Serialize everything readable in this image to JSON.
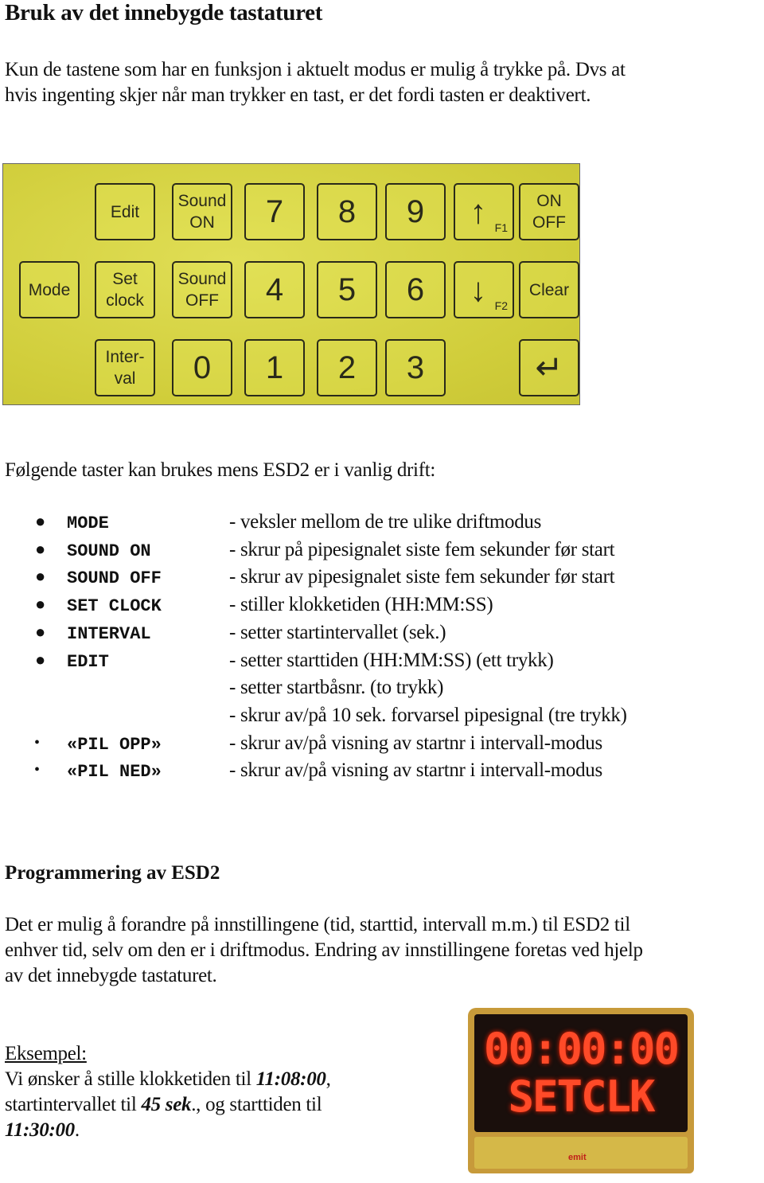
{
  "title": "Bruk av det innebygde tastaturet",
  "intro": [
    "Kun de tastene som har en funksjon i aktuelt modus er mulig å trykke på.  Dvs at",
    "hvis ingenting skjer når man trykker en tast, er det fordi tasten er deaktivert."
  ],
  "keypad": {
    "image_description": "Photo of the built-in yellow membrane keypad",
    "rows": [
      [
        {
          "label_lines": [
            "Edit"
          ],
          "type": "text"
        },
        {
          "label_lines": [
            "Sound",
            "ON"
          ],
          "type": "text"
        },
        {
          "label_lines": [
            "7"
          ],
          "type": "num"
        },
        {
          "label_lines": [
            "8"
          ],
          "type": "num"
        },
        {
          "label_lines": [
            "9"
          ],
          "type": "num"
        },
        {
          "label_lines": [
            "↑"
          ],
          "fn": "F1",
          "type": "arrow"
        },
        {
          "label_lines": [
            "ON",
            "OFF"
          ],
          "type": "text"
        }
      ],
      [
        {
          "label_lines": [
            "Mode"
          ],
          "type": "text"
        },
        {
          "label_lines": [
            "Set",
            "clock"
          ],
          "type": "text"
        },
        {
          "label_lines": [
            "Sound",
            "OFF"
          ],
          "type": "text"
        },
        {
          "label_lines": [
            "4"
          ],
          "type": "num"
        },
        {
          "label_lines": [
            "5"
          ],
          "type": "num"
        },
        {
          "label_lines": [
            "6"
          ],
          "type": "num"
        },
        {
          "label_lines": [
            "↓"
          ],
          "fn": "F2",
          "type": "arrow"
        },
        {
          "label_lines": [
            "Clear"
          ],
          "type": "text"
        }
      ],
      [
        {
          "label_lines": [
            "Inter-",
            "val"
          ],
          "type": "text"
        },
        {
          "label_lines": [
            "0"
          ],
          "type": "num"
        },
        {
          "label_lines": [
            "1"
          ],
          "type": "num"
        },
        {
          "label_lines": [
            "2"
          ],
          "type": "num"
        },
        {
          "label_lines": [
            "3"
          ],
          "type": "num"
        },
        {
          "label_lines": [
            "↵"
          ],
          "type": "enter"
        }
      ]
    ]
  },
  "normal_mode": {
    "heading": "Følgende taster kan brukes mens ESD2 er i vanlig drift:",
    "keys": [
      {
        "bullet": "●",
        "name": "MODE",
        "desc": "- veksler mellom de tre ulike driftmodus"
      },
      {
        "bullet": "●",
        "name": "SOUND ON",
        "desc": "- skrur på pipesignalet siste fem sekunder før start"
      },
      {
        "bullet": "●",
        "name": "SOUND OFF",
        "desc": "- skrur av pipesignalet siste fem sekunder før start"
      },
      {
        "bullet": "●",
        "name": "SET CLOCK",
        "desc": "- stiller klokketiden (HH:MM:SS)"
      },
      {
        "bullet": "●",
        "name": "INTERVAL",
        "desc": "- setter startintervallet (sek.)"
      },
      {
        "bullet": "●",
        "name": "EDIT",
        "desc": "- setter starttiden (HH:MM:SS) (ett trykk)"
      },
      {
        "bullet": "",
        "name": "",
        "desc": "- setter startbåsnr. (to trykk)"
      },
      {
        "bullet": "",
        "name": "",
        "desc": "- skrur av/på 10 sek. forvarsel pipesignal (tre trykk)"
      },
      {
        "bullet": "•",
        "name": "«PIL OPP»",
        "desc": "- skrur av/på visning av startnr i intervall-modus"
      },
      {
        "bullet": "•",
        "name": "«PIL NED»",
        "desc": "- skrur av/på visning av startnr i intervall-modus"
      }
    ]
  },
  "programming": {
    "heading": "Programmering av ESD2",
    "text": [
      "Det er mulig å forandre på innstillingene (tid, starttid, intervall m.m.) til ESD2 til",
      "enhver tid, selv om den er i driftmodus.  Endring av innstillingene foretas ved hjelp",
      "av det innebygde tastaturet."
    ]
  },
  "example": {
    "label": "Eksempel:",
    "line1_pre": "Vi ønsker å stille klokketiden til ",
    "clock_time": "11:08:00",
    "line1_post": ",",
    "line2_pre": "startintervallet til ",
    "interval": "45 sek",
    "line2_post": "., og starttiden  til",
    "start_time": "11:30:00",
    "line3_post": "."
  },
  "display": {
    "line1": "00:00:00",
    "line2": "SETCLK",
    "brand": "emit"
  },
  "colors": {
    "keypad_bg": "#d7d53f",
    "led": "#ff4a28",
    "display_frame": "#c79a3a"
  }
}
